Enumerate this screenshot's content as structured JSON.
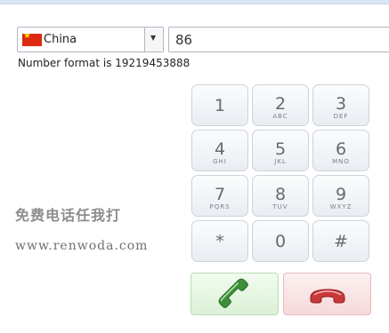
{
  "country": {
    "name": "China",
    "flag": "china-flag"
  },
  "phone": {
    "value": "86"
  },
  "format_hint": "Number format is 19219453888",
  "keypad": {
    "keys": [
      {
        "digit": "1",
        "letters": ""
      },
      {
        "digit": "2",
        "letters": "ABC"
      },
      {
        "digit": "3",
        "letters": "DEF"
      },
      {
        "digit": "4",
        "letters": "GHI"
      },
      {
        "digit": "5",
        "letters": "JKL"
      },
      {
        "digit": "6",
        "letters": "MNO"
      },
      {
        "digit": "7",
        "letters": "PQRS"
      },
      {
        "digit": "8",
        "letters": "TUV"
      },
      {
        "digit": "9",
        "letters": "WXYZ"
      },
      {
        "digit": "*",
        "letters": ""
      },
      {
        "digit": "0",
        "letters": ""
      },
      {
        "digit": "#",
        "letters": ""
      }
    ]
  },
  "actions": {
    "call_icon": "phone-call-icon",
    "hangup_icon": "phone-hangup-icon"
  },
  "watermark": {
    "text": "免费电话任我打",
    "url": "www.renwoda.com"
  },
  "colors": {
    "call_green": "#5cb85c",
    "hangup_red": "#d9534f",
    "key_text": "#666a70"
  }
}
